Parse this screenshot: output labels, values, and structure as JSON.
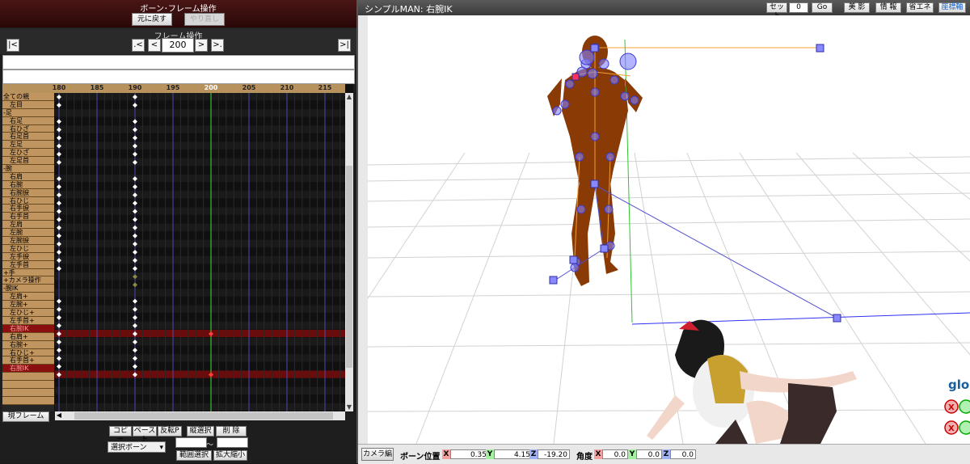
{
  "left_panel": {
    "title": "ボーン･フレーム操作",
    "undo": "元に戻す",
    "redo": "やり直し",
    "frame_ops_title": "フレーム操作",
    "nav": {
      "first": "|<",
      "prev_key": ".<",
      "prev": "<",
      "next": ">",
      "next_key": ">.",
      "last": ">|"
    },
    "frame_value": "200",
    "ruler_labels": [
      "180",
      "185",
      "190",
      "195",
      "200",
      "205",
      "210",
      "215"
    ],
    "bone_rows": [
      "全ての親",
      "左目",
      "-足",
      "右足",
      "右ひざ",
      "右足首",
      "左足",
      "左ひざ",
      "左足首",
      "-腕",
      "右肩",
      "右腕",
      "右腕捩",
      "右ひじ",
      "右手捩",
      "右手首",
      "左肩",
      "左腕",
      "左腕捩",
      "左ひじ",
      "左手捩",
      "左手首",
      "+手",
      "+カメラ操作",
      "-腕IK",
      "左肩+",
      "左腕+",
      "左ひじ+",
      "左手首+",
      "右腕IK",
      "右肩+",
      "右腕+",
      "右ひじ+",
      "右手首+",
      "右腕IK",
      "",
      "",
      "",
      ""
    ],
    "current_frame_btn": "現フレーム",
    "buttons": {
      "copy": "コピー",
      "paste": "ペースト",
      "paste_inv": "反転P",
      "vsel": "縦選択",
      "delete": "削 除",
      "range": "範囲選択",
      "zoom": "拡大縮小"
    },
    "select_dropdown": "選択ボーン",
    "tilde": "～",
    "colors": {
      "header_bg": "#3a0f0f",
      "bone_label_bg": "#c0955f",
      "selected_row": "#8a1010"
    }
  },
  "viewport": {
    "title": "シンプルMAN: 右腕IK",
    "tools": {
      "set": "セット",
      "set_value": "0",
      "go": "Go",
      "beauty": "美 影",
      "info": "情 報",
      "save_energy": "省エネ",
      "coord": "座標軸"
    },
    "overlay_label": "glo",
    "axis_letters": {
      "x": "X",
      "y": "Y",
      "z": "Z"
    }
  },
  "status": {
    "camera_btn": "カメラ編",
    "bone_pos_label": "ボーン位置",
    "pos": {
      "x": "0.35",
      "y": "4.15",
      "z": "-19.20"
    },
    "angle_label": "角度",
    "angle": {
      "x": "0.0",
      "y": "0.0",
      "z": "0.0"
    }
  }
}
